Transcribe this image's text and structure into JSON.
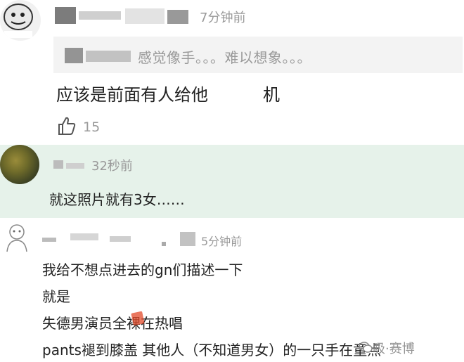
{
  "comment1": {
    "time": "7分钟前",
    "quote_text": "感觉像手。。。难以想象。。。",
    "text_before": "应该是前面有人给他",
    "text_after": "机",
    "like_count": "15"
  },
  "comment2": {
    "time": "32秒前",
    "text": "就这照片就有3女……"
  },
  "comment3": {
    "time": "5分钟前",
    "lines": [
      "我给不想点进去的gn们描述一下",
      "就是",
      "失德男演员全裸在热唱",
      "pants褪到膝盖 其他人（不知道男女）的一只手在童点"
    ]
  },
  "watermark": "吸·赛博"
}
